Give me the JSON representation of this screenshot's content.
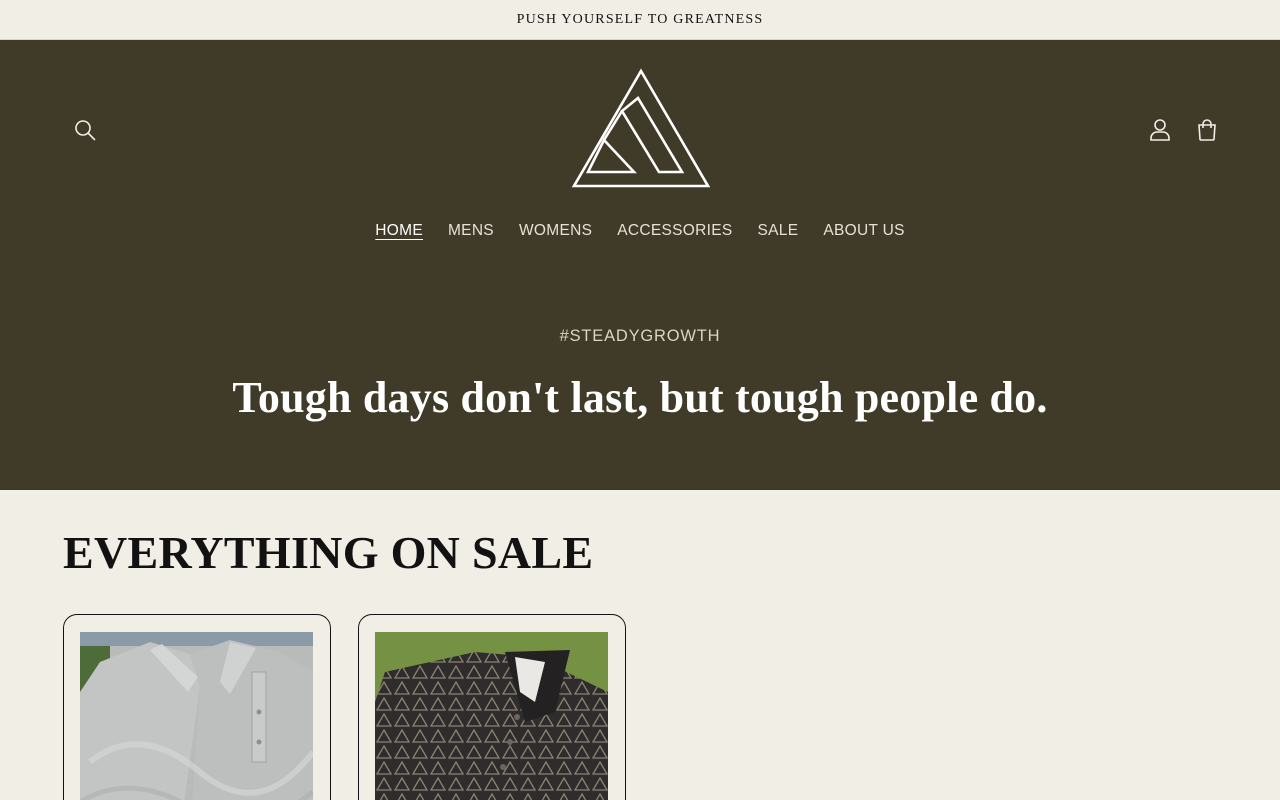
{
  "announcement": {
    "text": "PUSH YOURSELF TO GREATNESS"
  },
  "header": {
    "icons": {
      "search": "search-icon",
      "account": "account-icon",
      "cart": "cart-icon",
      "logo": "triangle-mountain-logo"
    },
    "nav": [
      {
        "label": "HOME",
        "active": true
      },
      {
        "label": "MENS"
      },
      {
        "label": "WOMENS"
      },
      {
        "label": "ACCESSORIES"
      },
      {
        "label": "SALE"
      },
      {
        "label": "ABOUT US"
      }
    ]
  },
  "hero": {
    "kicker": "#STEADYGROWTH",
    "title": "Tough days don't last, but tough people do."
  },
  "collection": {
    "title": "EVERYTHING ON SALE",
    "products": [
      {
        "image": "grey-polo-shirt-photo"
      },
      {
        "image": "black-patterned-polo-on-grass-photo"
      }
    ]
  },
  "colors": {
    "header_bg": "#403a29",
    "page_bg": "#f1eee6",
    "text": "#121212"
  }
}
